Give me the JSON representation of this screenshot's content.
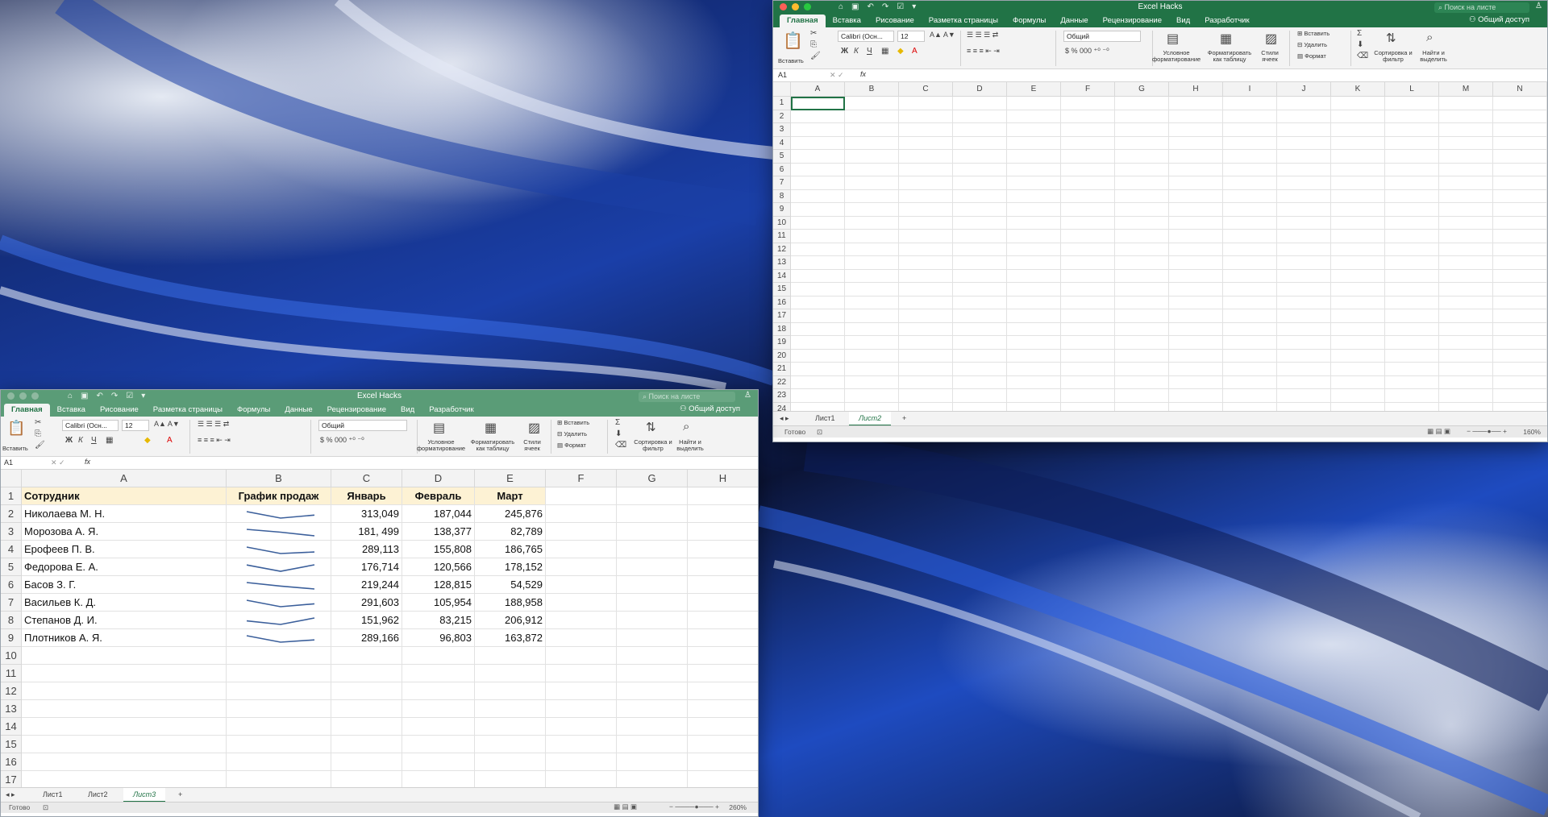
{
  "colors": {
    "excel_green": "#217346",
    "header_fill": "#fdf2d4"
  },
  "win_small": {
    "title": "Excel Hacks",
    "search_placeholder": "Поиск на листе",
    "share_label": "Общий доступ",
    "tabs": [
      "Главная",
      "Вставка",
      "Рисование",
      "Разметка страницы",
      "Формулы",
      "Данные",
      "Рецензирование",
      "Вид",
      "Разработчик"
    ],
    "ribbon": {
      "paste": "Вставить",
      "font_name": "Calibri (Осн...",
      "font_size": "12",
      "number_format": "Общий",
      "conditional": "Условное форматирование",
      "format_table": "Форматировать как таблицу",
      "cell_styles": "Стили ячеек",
      "insert": "Вставить",
      "delete": "Удалить",
      "format": "Формат",
      "sort": "Сортировка и фильтр",
      "find": "Найти и выделить"
    },
    "name_box": "A1",
    "columns": [
      "A",
      "B",
      "C",
      "D",
      "E",
      "F",
      "G",
      "H"
    ],
    "rows": [
      "1",
      "2",
      "3",
      "4",
      "5",
      "6",
      "7",
      "8",
      "9",
      "10",
      "11",
      "12",
      "13",
      "14",
      "15",
      "16",
      "17"
    ],
    "table": {
      "headers": [
        "Сотрудник",
        "График продаж",
        "Январь",
        "Февраль",
        "Март"
      ],
      "data": [
        {
          "name": "Николаева М. Н.",
          "jan": "313,049",
          "feb": "187,044",
          "mar": "245,876"
        },
        {
          "name": "Морозова А. Я.",
          "jan": "181, 499",
          "feb": "138,377",
          "mar": "82,789"
        },
        {
          "name": "Ерофеев П. В.",
          "jan": "289,113",
          "feb": "155,808",
          "mar": "186,765"
        },
        {
          "name": "Федорова Е. А.",
          "jan": "176,714",
          "feb": "120,566",
          "mar": "178,152"
        },
        {
          "name": "Басов З. Г.",
          "jan": "219,244",
          "feb": "128,815",
          "mar": "54,529"
        },
        {
          "name": "Васильев К. Д.",
          "jan": "291,603",
          "feb": "105,954",
          "mar": "188,958"
        },
        {
          "name": "Степанов Д. И.",
          "jan": "151,962",
          "feb": "83,215",
          "mar": "206,912"
        },
        {
          "name": "Плотников А. Я.",
          "jan": "289,166",
          "feb": "96,803",
          "mar": "163,872"
        }
      ]
    },
    "sheets": [
      "Лист1",
      "Лист2",
      "Лист3"
    ],
    "active_sheet": 2,
    "status": "Готово",
    "zoom": "260%"
  },
  "win_large": {
    "title": "Excel Hacks",
    "search_placeholder": "Поиск на листе",
    "share_label": "Общий доступ",
    "tabs": [
      "Главная",
      "Вставка",
      "Рисование",
      "Разметка страницы",
      "Формулы",
      "Данные",
      "Рецензирование",
      "Вид",
      "Разработчик"
    ],
    "ribbon": {
      "paste": "Вставить",
      "font_name": "Calibri (Осн...",
      "font_size": "12",
      "number_format": "Общий",
      "conditional": "Условное форматирование",
      "format_table": "Форматировать как таблицу",
      "cell_styles": "Стили ячеек",
      "insert": "Вставить",
      "delete": "Удалить",
      "format": "Формат",
      "sort": "Сортировка и фильтр",
      "find": "Найти и выделить"
    },
    "name_box": "A1",
    "columns": [
      "A",
      "B",
      "C",
      "D",
      "E",
      "F",
      "G",
      "H",
      "I",
      "J",
      "K",
      "L",
      "M",
      "N"
    ],
    "rows": [
      "1",
      "2",
      "3",
      "4",
      "5",
      "6",
      "7",
      "8",
      "9",
      "10",
      "11",
      "12",
      "13",
      "14",
      "15",
      "16",
      "17",
      "18",
      "19",
      "20",
      "21",
      "22",
      "23",
      "24"
    ],
    "sheets": [
      "Лист1",
      "Лист2"
    ],
    "active_sheet": 1,
    "status": "Готово",
    "zoom": "160%"
  }
}
